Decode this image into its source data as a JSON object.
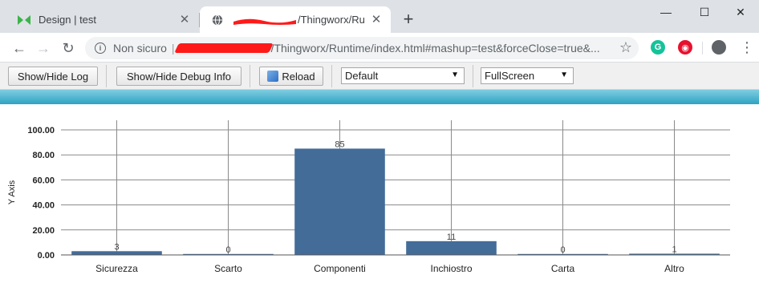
{
  "browser": {
    "tabs": [
      {
        "title": "Design | test",
        "active": false,
        "icon": "thingworx-logo-icon"
      },
      {
        "title": "/Thingworx/Ru",
        "active": true,
        "icon": "globe-icon"
      }
    ],
    "new_tab": "+",
    "window_controls": {
      "minimize": "—",
      "maximize": "☐",
      "close": "✕"
    }
  },
  "address_bar": {
    "security_label": "Non sicuro",
    "url": "/Thingworx/Runtime/index.html#mashup=test&forceClose=true&..."
  },
  "debug_toolbar": {
    "show_hide_log": "Show/Hide Log",
    "show_hide_debug": "Show/Hide Debug Info",
    "reload": "Reload",
    "theme_select": "Default",
    "view_select": "FullScreen"
  },
  "colors": {
    "bar": "#436c99",
    "band_top": "#7fcde0",
    "band_bottom": "#2ea3c2"
  },
  "chart_data": {
    "type": "bar",
    "title": "",
    "xlabel": "",
    "ylabel": "Y Axis",
    "ylim": [
      0,
      100
    ],
    "yticks": [
      "0.00",
      "20.00",
      "40.00",
      "60.00",
      "80.00",
      "100.00"
    ],
    "categories": [
      "Sicurezza",
      "Scarto",
      "Componenti",
      "Inchiostro",
      "Carta",
      "Altro"
    ],
    "values": [
      3,
      0,
      85,
      11,
      0,
      1
    ],
    "data_labels": [
      "3",
      "0",
      "85",
      "11",
      "0",
      "1"
    ],
    "grid": true,
    "legend": "none"
  }
}
